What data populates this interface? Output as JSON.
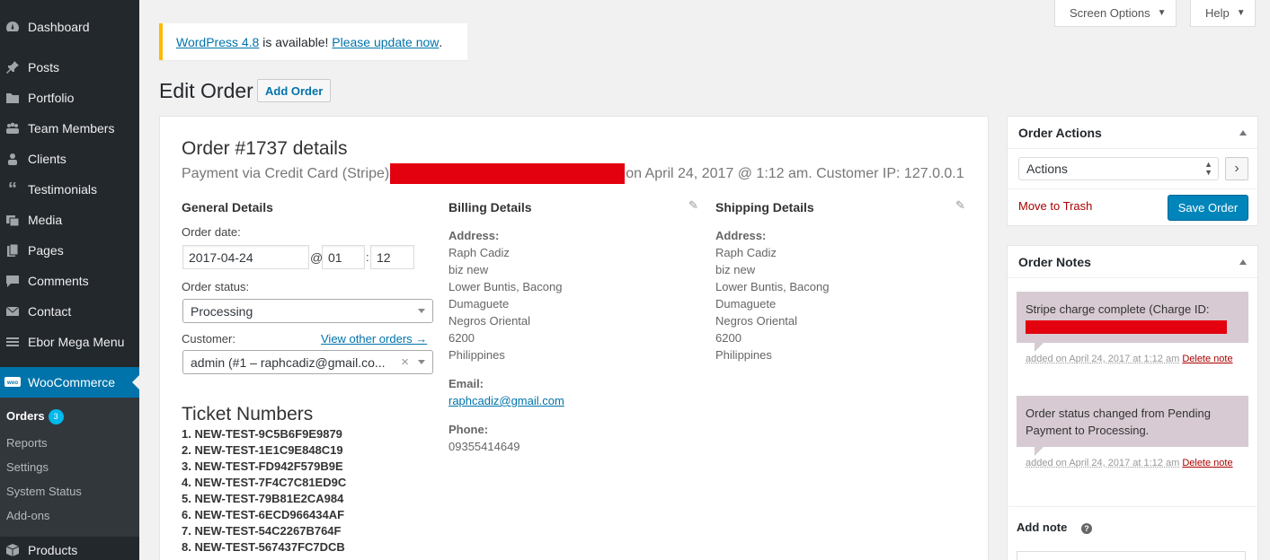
{
  "sidebar": {
    "items": [
      {
        "label": "Dashboard",
        "icon": "dashboard-icon"
      },
      {
        "label": "Posts",
        "icon": "pin-icon"
      },
      {
        "label": "Portfolio",
        "icon": "folder-icon"
      },
      {
        "label": "Team Members",
        "icon": "team-icon"
      },
      {
        "label": "Clients",
        "icon": "user-icon"
      },
      {
        "label": "Testimonials",
        "icon": "quote-icon"
      },
      {
        "label": "Media",
        "icon": "media-icon"
      },
      {
        "label": "Pages",
        "icon": "pages-icon"
      },
      {
        "label": "Comments",
        "icon": "comment-icon"
      },
      {
        "label": "Contact",
        "icon": "mail-icon"
      },
      {
        "label": "Ebor Mega Menu",
        "icon": "menu-icon"
      },
      {
        "label": "WooCommerce",
        "icon": "woo-icon"
      },
      {
        "label": "Products",
        "icon": "cube-icon"
      }
    ],
    "submenu": {
      "orders_label": "Orders",
      "orders_count": "3",
      "reports": "Reports",
      "settings": "Settings",
      "system_status": "System Status",
      "addons": "Add-ons"
    }
  },
  "screen_meta": {
    "screen_options": "Screen Options",
    "help": "Help"
  },
  "notice": {
    "version_link": "WordPress 4.8",
    "middle_text": " is available! ",
    "update_link": "Please update now",
    "end_text": "."
  },
  "page": {
    "title": "Edit Order",
    "add_button": "Add Order"
  },
  "order": {
    "heading": "Order #1737 details",
    "payment_prefix": "Payment via Credit Card (Stripe)",
    "payment_suffix": "on April 24, 2017 @ 1:12 am. Customer IP: 127.0.0.1",
    "general": {
      "title": "General Details",
      "date_label": "Order date:",
      "date": "2017-04-24",
      "at": "@",
      "hour": "01",
      "colon": ":",
      "minute": "12",
      "status_label": "Order status:",
      "status": "Processing",
      "customer_label": "Customer:",
      "view_other": "View other orders →",
      "customer": "admin (#1 – raphcadiz@gmail.co...",
      "clear": "×"
    },
    "billing": {
      "title": "Billing Details",
      "address_label": "Address:",
      "address_lines": [
        "Raph Cadiz",
        "biz new",
        "Lower Buntis, Bacong",
        "Dumaguete",
        "Negros Oriental",
        "6200",
        "Philippines"
      ],
      "email_label": "Email:",
      "email": "raphcadiz@gmail.com",
      "phone_label": "Phone:",
      "phone": "09355414649"
    },
    "shipping": {
      "title": "Shipping Details",
      "address_label": "Address:",
      "address_lines": [
        "Raph Cadiz",
        "biz new",
        "Lower Buntis, Bacong",
        "Dumaguete",
        "Negros Oriental",
        "6200",
        "Philippines"
      ]
    },
    "tickets": {
      "title": "Ticket Numbers",
      "items": [
        "1. NEW-TEST-9C5B6F9E9879",
        "2. NEW-TEST-1E1C9E848C19",
        "3. NEW-TEST-FD942F579B9E",
        "4. NEW-TEST-7F4C7C81ED9C",
        "5. NEW-TEST-79B81E2CA984",
        "6. NEW-TEST-6ECD966434AF",
        "7. NEW-TEST-54C2267B764F",
        "8. NEW-TEST-567437FC7DCB"
      ]
    }
  },
  "actions_box": {
    "title": "Order Actions",
    "select": "Actions",
    "go": "›",
    "trash": "Move to Trash",
    "save": "Save Order"
  },
  "notes_box": {
    "title": "Order Notes",
    "notes": [
      {
        "text": "Stripe charge complete (Charge ID:",
        "meta": "added on April 24, 2017 at 1:12 am",
        "delete": "Delete note"
      },
      {
        "text": "Order status changed from Pending Payment to Processing.",
        "meta": "added on April 24, 2017 at 1:12 am",
        "delete": "Delete note"
      }
    ],
    "add_note": "Add note",
    "help": "?"
  },
  "colors": {
    "sidebar": "#23282d",
    "active": "#0073aa",
    "link": "#0073aa",
    "redaction": "#e3000f",
    "note": "#d7cad2",
    "delete": "#a00"
  }
}
